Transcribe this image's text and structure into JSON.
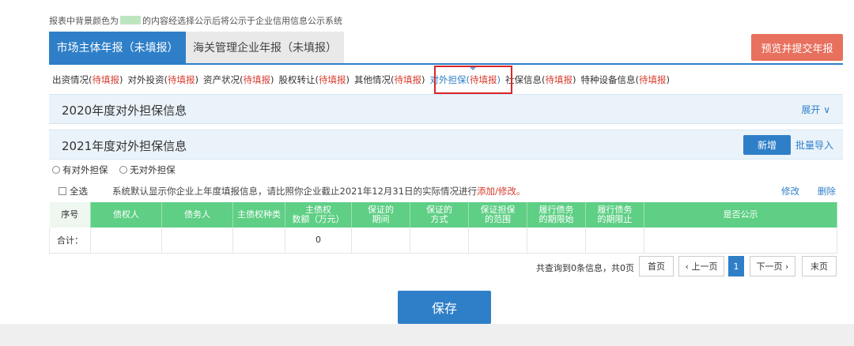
{
  "notice": {
    "before": "报表中背景颜色为",
    "after": "的内容经选择公示后将公示于企业信用信息公示系统"
  },
  "tabs": [
    {
      "label": "市场主体年报（未填报）"
    },
    {
      "label": "海关管理企业年报（未填报）"
    }
  ],
  "preview_button": "预览并提交年报",
  "subnav": [
    {
      "label": "出资情况",
      "status": "待填报"
    },
    {
      "label": "对外投资",
      "status": "待填报"
    },
    {
      "label": "资产状况",
      "status": "待填报"
    },
    {
      "label": "股权转让",
      "status": "待填报"
    },
    {
      "label": "其他情况",
      "status": "待填报"
    },
    {
      "label": "对外担保",
      "status": "待填报"
    },
    {
      "label": "社保信息",
      "status": "待填报"
    },
    {
      "label": "特种设备信息",
      "status": "待填报"
    }
  ],
  "panel2020": {
    "title": "2020年度对外担保信息",
    "expand": "展开"
  },
  "panel2021": {
    "title": "2021年度对外担保信息",
    "new_button": "新增",
    "import_link": "批量导入"
  },
  "radios": {
    "has": "有对外担保",
    "none": "无对外担保"
  },
  "select_all": "全选",
  "hint": {
    "text": "系统默认显示你企业上年度填报信息，请比照你企业截止2021年12月31日的实际情况进行",
    "action": "添加/修改。"
  },
  "actions": {
    "edit": "修改",
    "delete": "删除"
  },
  "table": {
    "headers": [
      "序号",
      "债权人",
      "债务人",
      "主债权种类",
      "主债权\n数额（万元）",
      "保证的\n期间",
      "保证的\n方式",
      "保证担保\n的范围",
      "履行债务\n的期限始",
      "履行债务\n的期限止",
      "是否公示"
    ],
    "total_row": [
      "合计：",
      "",
      "",
      "",
      "0",
      "",
      "",
      "",
      "",
      "",
      ""
    ]
  },
  "pagination": {
    "summary": "共查询到0条信息，共0页",
    "first": "首页",
    "prev": "上一页",
    "current": "1",
    "next": "下一页",
    "last": "末页"
  },
  "save_button": "保存",
  "colors": {
    "primary": "#2f7fc8",
    "header_green": "#5ecf84",
    "pending_red": "#d63b2c",
    "preview_button": "#e8705e"
  }
}
